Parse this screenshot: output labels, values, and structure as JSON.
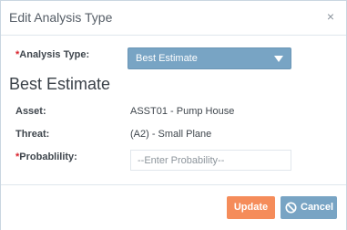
{
  "dialog": {
    "title": "Edit Analysis Type",
    "close_symbol": "×"
  },
  "form": {
    "analysis_type": {
      "required_marker": "*",
      "label": "Analysis Type:",
      "selected": "Best Estimate"
    },
    "section_title": "Best Estimate",
    "asset": {
      "label": "Asset:",
      "value": "ASST01 - Pump House"
    },
    "threat": {
      "label": "Threat:",
      "value": "(A2) - Small Plane"
    },
    "probability": {
      "required_marker": "*",
      "label": "Probablility:",
      "placeholder": "--Enter Probability--",
      "value": ""
    }
  },
  "footer": {
    "update_label": "Update",
    "cancel_label": "Cancel"
  },
  "colors": {
    "primary_blue": "#78a4c4",
    "update_orange": "#f58c5a",
    "required_red": "#d9232d"
  },
  "icons": {
    "close": "close-icon",
    "dropdown": "caret-down-icon",
    "cancel": "ban-icon"
  }
}
